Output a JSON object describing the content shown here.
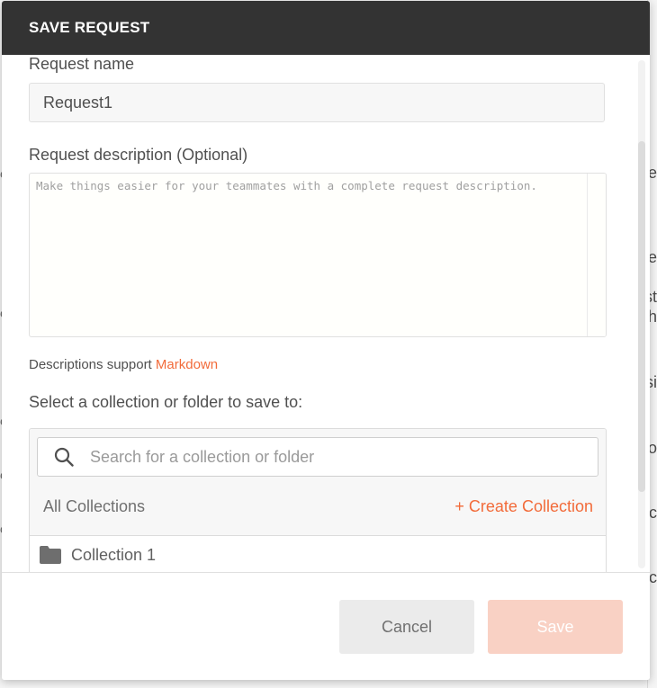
{
  "modal": {
    "title": "SAVE REQUEST"
  },
  "request_name": {
    "label": "Request name",
    "value": "Request1"
  },
  "request_description": {
    "label": "Request description (Optional)",
    "placeholder": "Make things easier for your teammates with a complete request description."
  },
  "markdown_note": {
    "prefix": "Descriptions support",
    "link_label": "Markdown"
  },
  "collection_picker": {
    "label": "Select a collection or folder to save to:",
    "search_placeholder": "Search for a collection or folder",
    "all_collections_label": "All Collections",
    "create_collection_label": "+ Create Collection",
    "collections": [
      {
        "name": "Collection 1",
        "icon": "folder-icon"
      }
    ]
  },
  "footer": {
    "cancel_label": "Cancel",
    "save_label": "Save"
  },
  "colors": {
    "header_bg": "#333333",
    "accent": "#f26b3a",
    "save_disabled_bg": "#f9d1c4",
    "cancel_bg": "#ebebeb"
  },
  "background": {
    "right_glyphs": [
      "e",
      "te",
      "st",
      "h",
      "si",
      "o",
      "c",
      "c"
    ],
    "left_glyphs": [
      "e",
      "e",
      "e",
      "e",
      "c"
    ]
  }
}
